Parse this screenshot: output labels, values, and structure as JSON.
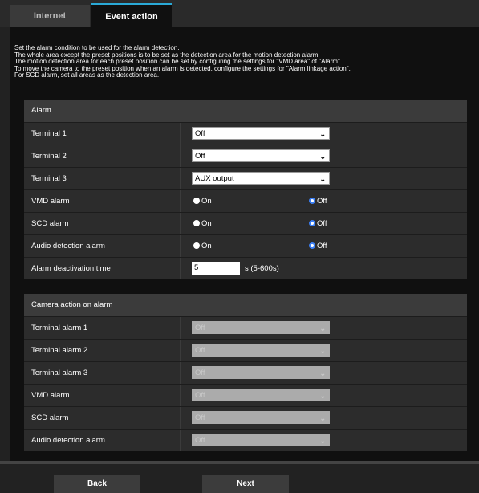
{
  "tabs": [
    {
      "label": "Internet"
    },
    {
      "label": "Event action"
    }
  ],
  "intro": [
    "Set the alarm condition to be used for the alarm detection.",
    "The whole area except the preset positions is to be set as the detection area for the motion detection alarm.",
    "The motion detection area for each preset position can be set by configuring the settings for \"VMD area\" of \"Alarm\".",
    "To move the camera to the preset position when an alarm is detected, configure the settings for \"Alarm linkage action\".",
    "For SCD alarm, set all areas as the detection area."
  ],
  "alarm": {
    "title": "Alarm",
    "terminal1": {
      "label": "Terminal 1",
      "value": "Off"
    },
    "terminal2": {
      "label": "Terminal 2",
      "value": "Off"
    },
    "terminal3": {
      "label": "Terminal 3",
      "value": "AUX output"
    },
    "vmd": {
      "label": "VMD alarm",
      "on": "On",
      "off": "Off",
      "selected": "Off"
    },
    "scd": {
      "label": "SCD alarm",
      "on": "On",
      "off": "Off",
      "selected": "Off"
    },
    "audio": {
      "label": "Audio detection alarm",
      "on": "On",
      "off": "Off",
      "selected": "Off"
    },
    "deactivation": {
      "label": "Alarm deactivation time",
      "value": "5",
      "unit": "s (5-600s)"
    }
  },
  "camera_action": {
    "title": "Camera action on alarm",
    "rows": [
      {
        "label": "Terminal alarm 1",
        "value": "Off"
      },
      {
        "label": "Terminal alarm 2",
        "value": "Off"
      },
      {
        "label": "Terminal alarm 3",
        "value": "Off"
      },
      {
        "label": "VMD alarm",
        "value": "Off"
      },
      {
        "label": "SCD alarm",
        "value": "Off"
      },
      {
        "label": "Audio detection alarm",
        "value": "Off"
      }
    ]
  },
  "buttons": {
    "back": "Back",
    "next": "Next"
  },
  "colors": {
    "background": "#222222",
    "panel": "#101010",
    "radio_accent": "#3b7ff5",
    "tab_accent": "#2aa9d6"
  }
}
